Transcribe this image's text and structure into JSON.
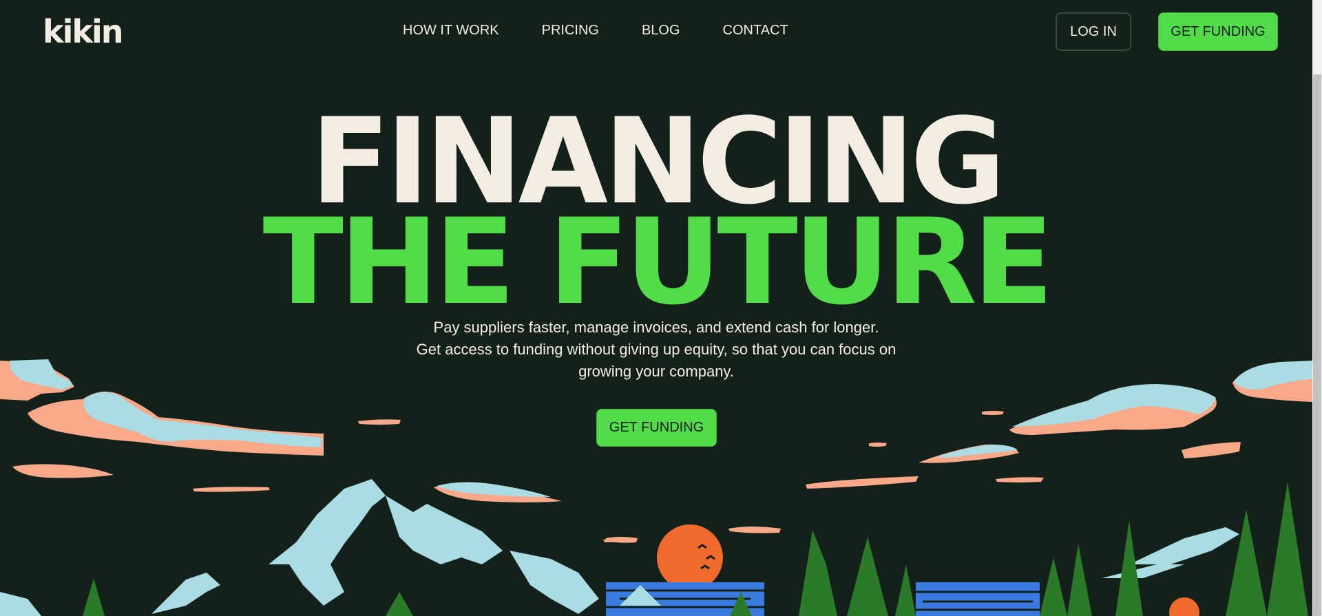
{
  "brand": {
    "logo_text": "kikin"
  },
  "nav": {
    "items": [
      {
        "label": "HOW IT WORK"
      },
      {
        "label": "PRICING"
      },
      {
        "label": "BLOG"
      },
      {
        "label": "CONTACT"
      }
    ],
    "login_label": "LOG IN",
    "get_funding_label": "GET FUNDING"
  },
  "hero": {
    "headline_line1": "FINANCING",
    "headline_line2": "THE FUTURE",
    "subtitle_line1": "Pay suppliers faster, manage invoices, and extend cash for longer.",
    "subtitle_line2": "Get access to funding without giving up equity, so that you can focus on",
    "subtitle_line3": "growing your company.",
    "cta_label": "GET FUNDING"
  },
  "colors": {
    "background": "#13211a",
    "cream": "#f4ede3",
    "accent_green": "#53dc4a",
    "cloud_blue": "#a9dce3",
    "cloud_peach": "#f8a98a",
    "sun_orange": "#ef6a2c",
    "water_blue": "#3b7be0",
    "tree_green": "#2a7a2a"
  },
  "illustration": {
    "icon": "mountain-landscape-illustration"
  }
}
